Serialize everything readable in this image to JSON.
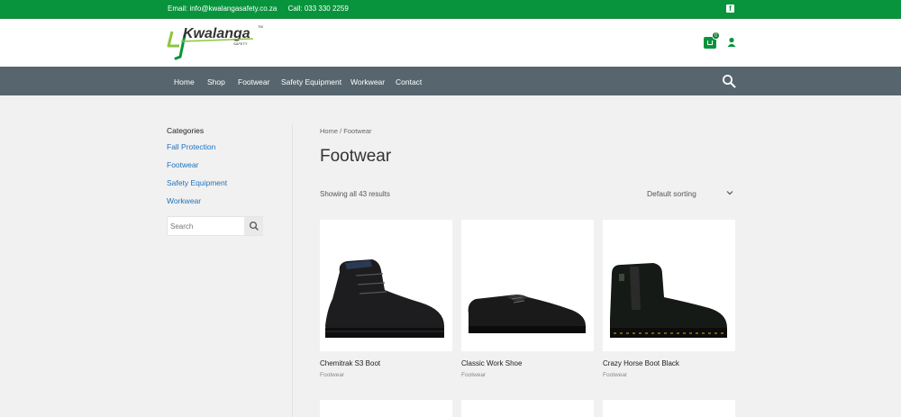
{
  "topbar": {
    "email": "Email: info@kwalangasafety.co.za",
    "phone": "Call: 033 330 2259",
    "facebook_icon": "facebook-icon"
  },
  "header": {
    "logo_text": "Kwalanga",
    "logo_sub": "SAFETY",
    "logo_tm": "TM",
    "cart_count": "0"
  },
  "nav": {
    "items": [
      "Home",
      "Shop",
      "Footwear",
      "Safety Equipment",
      "Workwear",
      "Contact"
    ]
  },
  "sidebar": {
    "heading": "Categories",
    "categories": [
      "Fall Protection",
      "Footwear",
      "Safety Equipment",
      "Workwear"
    ],
    "search_placeholder": "Search"
  },
  "main": {
    "breadcrumb_home": "Home",
    "breadcrumb_sep": " / ",
    "breadcrumb_current": "Footwear",
    "title": "Footwear",
    "result_count": "Showing all 43 results",
    "sorting": "Default sorting"
  },
  "products": [
    {
      "name": "Chemitrak S3 Boot",
      "category": "Footwear"
    },
    {
      "name": "Classic Work Shoe",
      "category": "Footwear"
    },
    {
      "name": "Crazy Horse Boot Black",
      "category": "Footwear"
    }
  ],
  "colors": {
    "brand_green": "#08943c",
    "nav_bg": "#57656e",
    "link_blue": "#1e73be"
  }
}
